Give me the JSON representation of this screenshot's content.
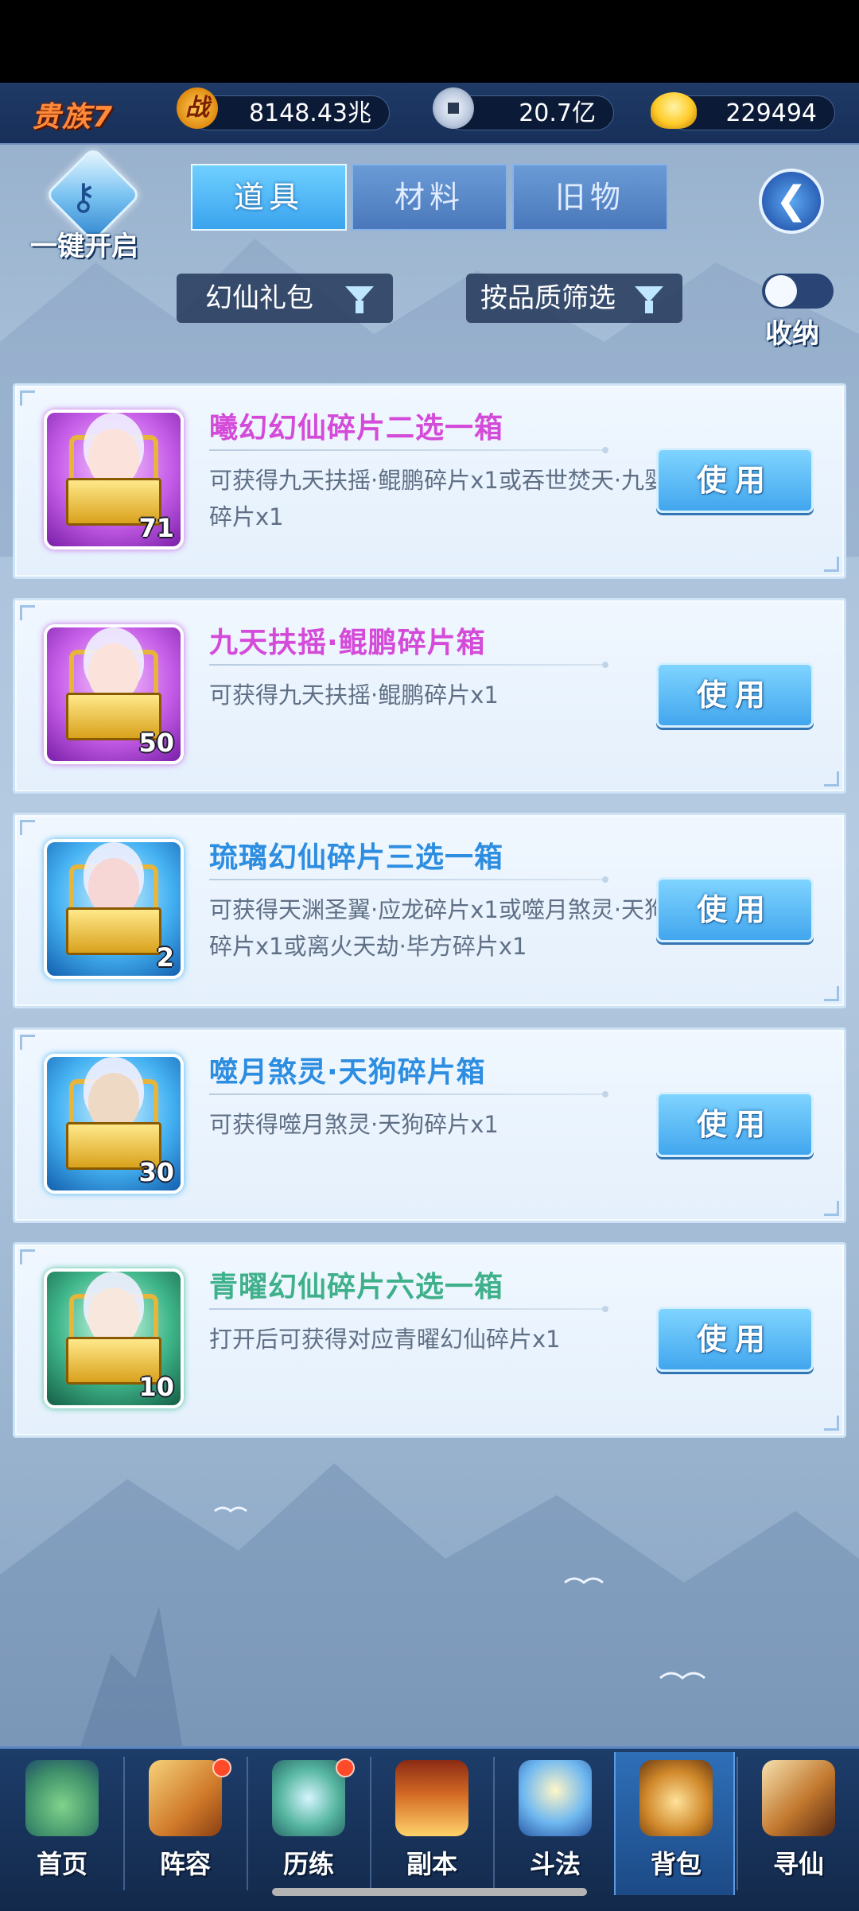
{
  "header": {
    "noble_label": "贵族7",
    "power_icon_glyph": "战",
    "power_value": "8148.43兆",
    "coin_value": "20.7亿",
    "gold_value": "229494"
  },
  "toolbar": {
    "one_key_label": "一键开启",
    "tabs": [
      {
        "label": "道具",
        "active": true
      },
      {
        "label": "材料",
        "active": false
      },
      {
        "label": "旧物",
        "active": false
      }
    ],
    "back_glyph": "❮"
  },
  "filters": {
    "category_label": "幻仙礼包",
    "quality_label": "按品质筛选",
    "collapse_label": "收纳",
    "collapse_on": false
  },
  "items": [
    {
      "name": "曦幻幻仙碎片二选一箱",
      "desc": "可获得九天扶摇·鲲鹏碎片x1或吞世焚天·九婴碎片x1",
      "count": "71",
      "button": "使用",
      "rarity": "purple"
    },
    {
      "name": "九天扶摇·鲲鹏碎片箱",
      "desc": "可获得九天扶摇·鲲鹏碎片x1",
      "count": "50",
      "button": "使用",
      "rarity": "purple"
    },
    {
      "name": "琉璃幻仙碎片三选一箱",
      "desc": "可获得天渊圣翼·应龙碎片x1或噬月煞灵·天狗碎片x1或离火天劫·毕方碎片x1",
      "count": "2",
      "button": "使用",
      "rarity": "blue"
    },
    {
      "name": "噬月煞灵·天狗碎片箱",
      "desc": "可获得噬月煞灵·天狗碎片x1",
      "count": "30",
      "button": "使用",
      "rarity": "blue"
    },
    {
      "name": "青曜幻仙碎片六选一箱",
      "desc": "打开后可获得对应青曜幻仙碎片x1",
      "count": "10",
      "button": "使用",
      "rarity": "green"
    }
  ],
  "bottom_nav": [
    {
      "label": "首页",
      "icon": "home-icon",
      "badge": false,
      "selected": false
    },
    {
      "label": "阵容",
      "icon": "lineup-icon",
      "badge": true,
      "selected": false
    },
    {
      "label": "历练",
      "icon": "training-icon",
      "badge": true,
      "selected": false
    },
    {
      "label": "副本",
      "icon": "dungeon-icon",
      "badge": false,
      "selected": false
    },
    {
      "label": "斗法",
      "icon": "battle-icon",
      "badge": false,
      "selected": false
    },
    {
      "label": "背包",
      "icon": "backpack-icon",
      "badge": false,
      "selected": true
    },
    {
      "label": "寻仙",
      "icon": "explore-icon",
      "badge": false,
      "selected": false
    }
  ],
  "colors": {
    "rarity_purple": "#d44ad9",
    "rarity_blue": "#2d8de0",
    "rarity_green": "#3eb08a",
    "button_blue": "#42a6ee"
  }
}
